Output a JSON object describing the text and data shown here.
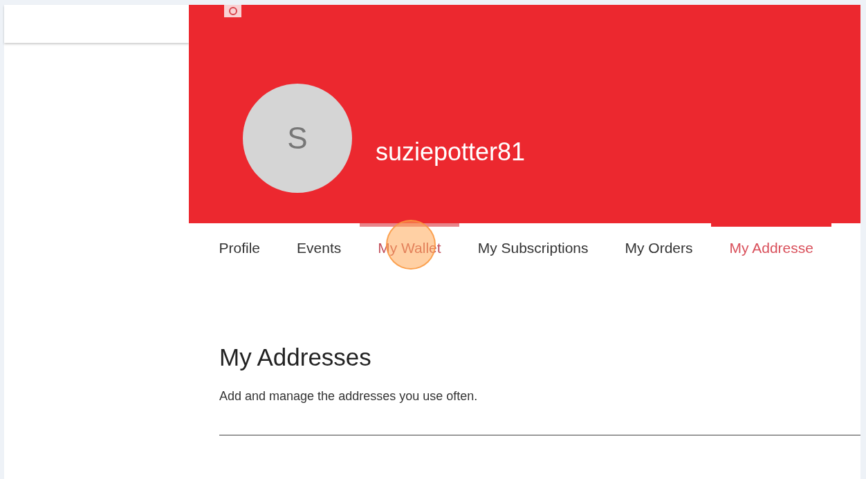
{
  "profile": {
    "avatar_letter": "S",
    "username": "suziepotter81"
  },
  "tabs": [
    {
      "label": "Profile",
      "selected": false,
      "hovered": false
    },
    {
      "label": "Events",
      "selected": false,
      "hovered": false
    },
    {
      "label": "My Wallet",
      "selected": false,
      "hovered": true
    },
    {
      "label": "My Subscriptions",
      "selected": false,
      "hovered": false
    },
    {
      "label": "My Orders",
      "selected": false,
      "hovered": false
    },
    {
      "label": "My Addresse",
      "selected": true,
      "hovered": false
    }
  ],
  "section": {
    "title": "My Addresses",
    "description": "Add and manage the addresses you use often."
  }
}
